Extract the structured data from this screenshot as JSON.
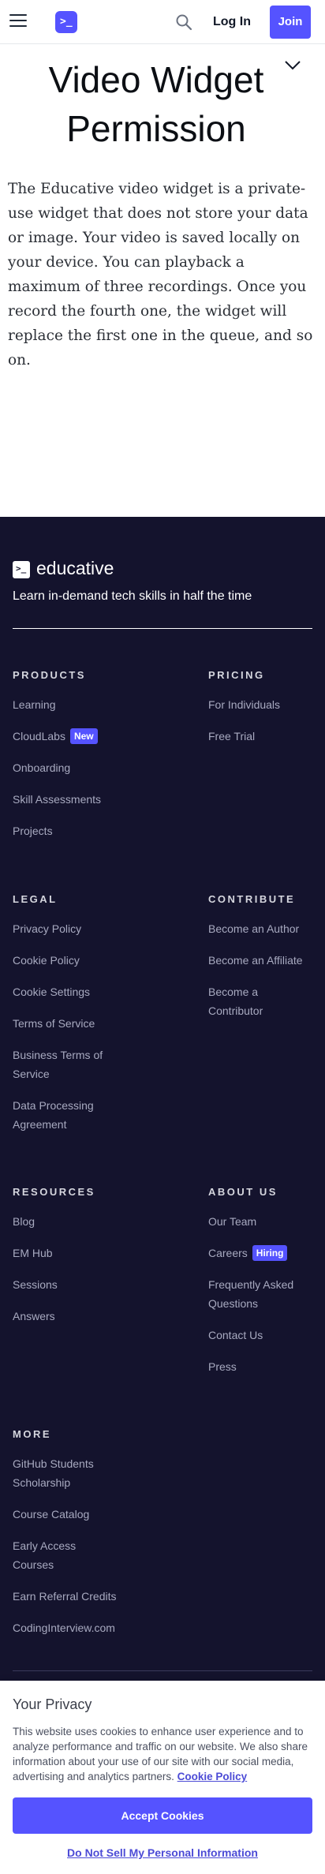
{
  "header": {
    "login_label": "Log In",
    "join_label": "Join",
    "logo_glyph": ">_"
  },
  "page": {
    "title_line1": "Video Widget",
    "title_line2": "Permission",
    "body": "The Educative video widget is a private-use widget that does not store your data or image. Your video is saved locally on your device. You can playback a maximum of three recordings. Once you record the fourth one, the widget will replace the first one in the queue, and so on."
  },
  "footer": {
    "brand": "educative",
    "tagline": "Learn in-demand tech skills in half the time",
    "products": {
      "heading": "PRODUCTS",
      "items": [
        "Learning",
        "CloudLabs",
        "Onboarding",
        "Skill Assessments",
        "Projects"
      ],
      "new_badge": "New"
    },
    "pricing": {
      "heading": "PRICING",
      "items": [
        "For Individuals",
        "Free Trial"
      ]
    },
    "legal": {
      "heading": "LEGAL",
      "items": [
        "Privacy Policy",
        "Cookie Policy",
        "Cookie Settings",
        "Terms of Service",
        "Business Terms of Service",
        "Data Processing Agreement"
      ]
    },
    "contribute": {
      "heading": "CONTRIBUTE",
      "items": [
        "Become an Author",
        "Become an Affiliate",
        "Become a Contributor"
      ]
    },
    "resources": {
      "heading": "RESOURCES",
      "items": [
        "Blog",
        "EM Hub",
        "Sessions",
        "Answers"
      ]
    },
    "about": {
      "heading": "ABOUT US",
      "items": [
        "Our Team",
        "Careers",
        "Frequently Asked Questions",
        "Contact Us",
        "Press"
      ],
      "hiring_badge": "Hiring"
    },
    "more": {
      "heading": "MORE",
      "items": [
        "GitHub Students Scholarship",
        "Course Catalog",
        "Early Access Courses",
        "Earn Referral Credits",
        "CodingInterview.com"
      ]
    }
  },
  "cookie": {
    "title": "Your Privacy",
    "text": "This website uses cookies to enhance user experience and to analyze performance and traffic on our website. We also share information about your use of our site with our social media, advertising and analytics partners.",
    "policy_link": "Cookie Policy",
    "accept_label": "Accept Cookies",
    "do_not_sell_label": "Do Not Sell My Personal Information"
  },
  "colors": {
    "brand": "#5553ff",
    "footer_bg": "#14132d"
  }
}
